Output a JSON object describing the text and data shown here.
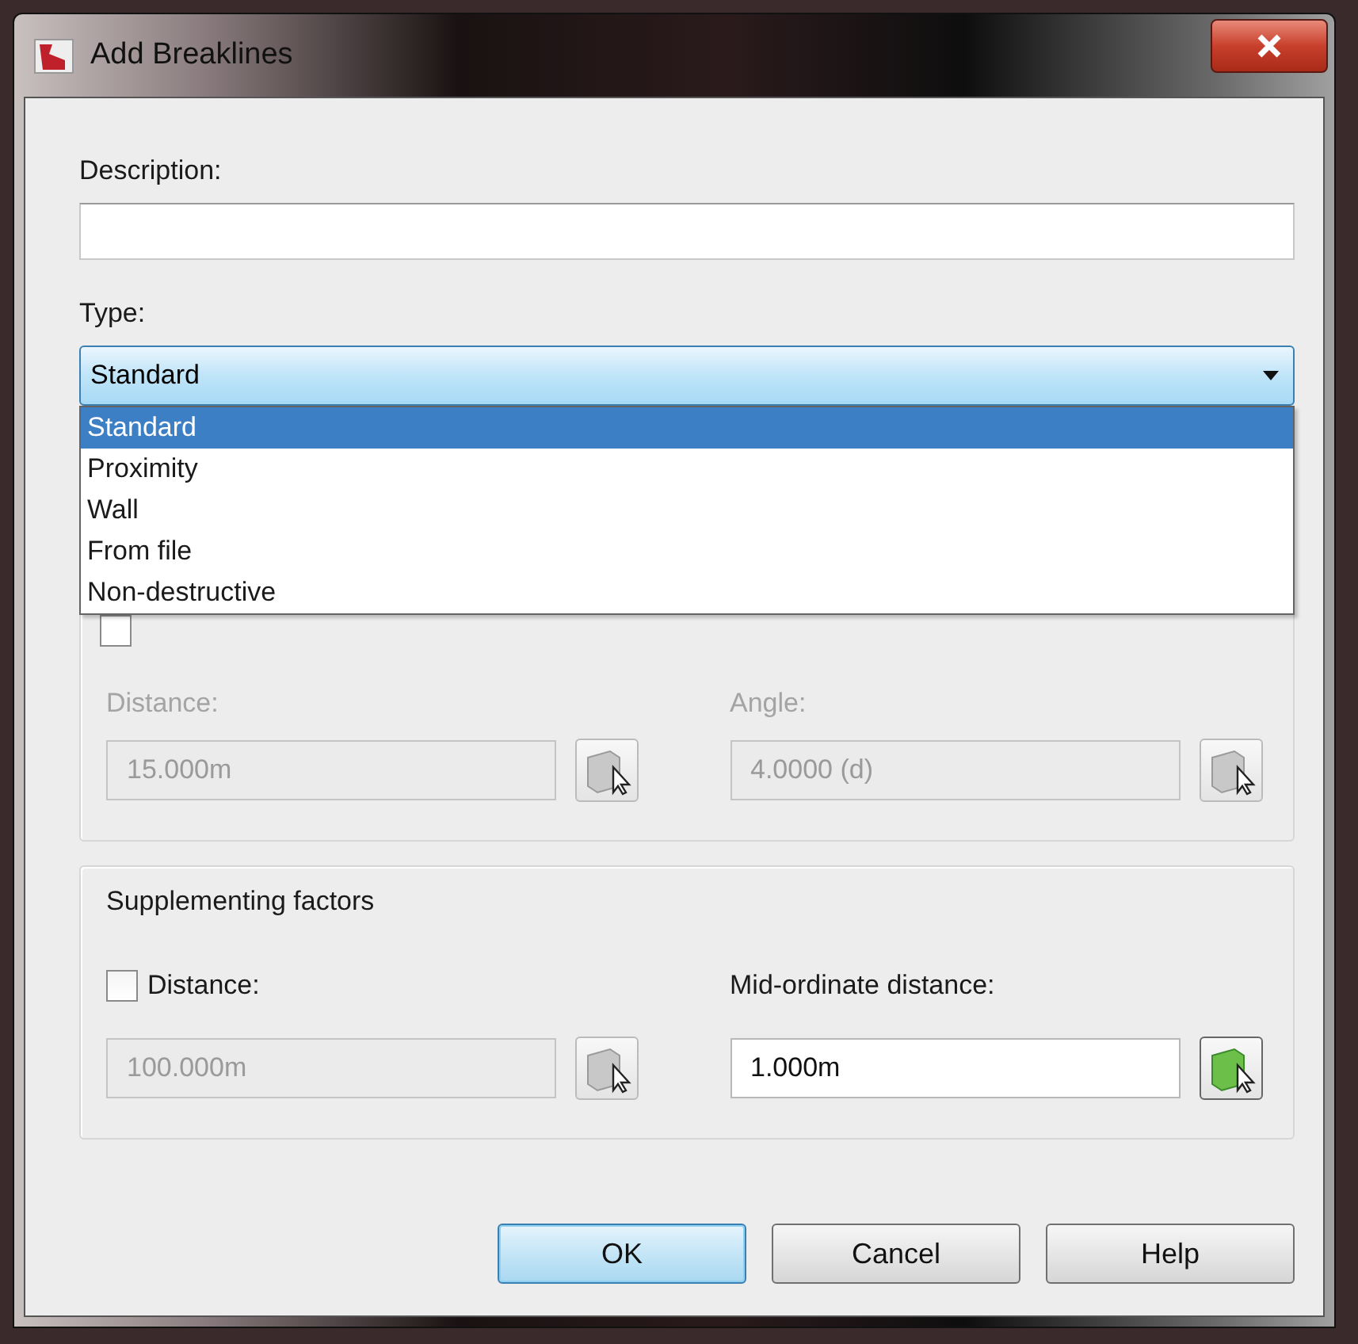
{
  "window": {
    "title": "Add Breaklines"
  },
  "description": {
    "label": "Description:"
  },
  "type": {
    "label": "Type:",
    "value": "Standard",
    "expanded": true,
    "options": [
      {
        "label": "Standard",
        "selected": true
      },
      {
        "label": "Proximity",
        "selected": false
      },
      {
        "label": "Wall",
        "selected": false
      },
      {
        "label": "From file",
        "selected": false
      },
      {
        "label": "Non-destructive",
        "selected": false
      }
    ]
  },
  "weeding": {
    "checked": false,
    "distance": {
      "label": "Distance:",
      "value": "15.000m",
      "disabled": true
    },
    "angle": {
      "label": "Angle:",
      "value": "4.0000 (d)",
      "disabled": true
    }
  },
  "supplementing": {
    "title": "Supplementing factors",
    "distance": {
      "label": "Distance:",
      "checked": false,
      "value": "100.000m",
      "disabled": true
    },
    "mid_ordinate": {
      "label": "Mid-ordinate distance:",
      "value": "1.000m",
      "disabled": false
    }
  },
  "buttons": [
    {
      "label": "OK",
      "default": true
    },
    {
      "label": "Cancel",
      "default": false
    },
    {
      "label": "Help",
      "default": false
    }
  ]
}
